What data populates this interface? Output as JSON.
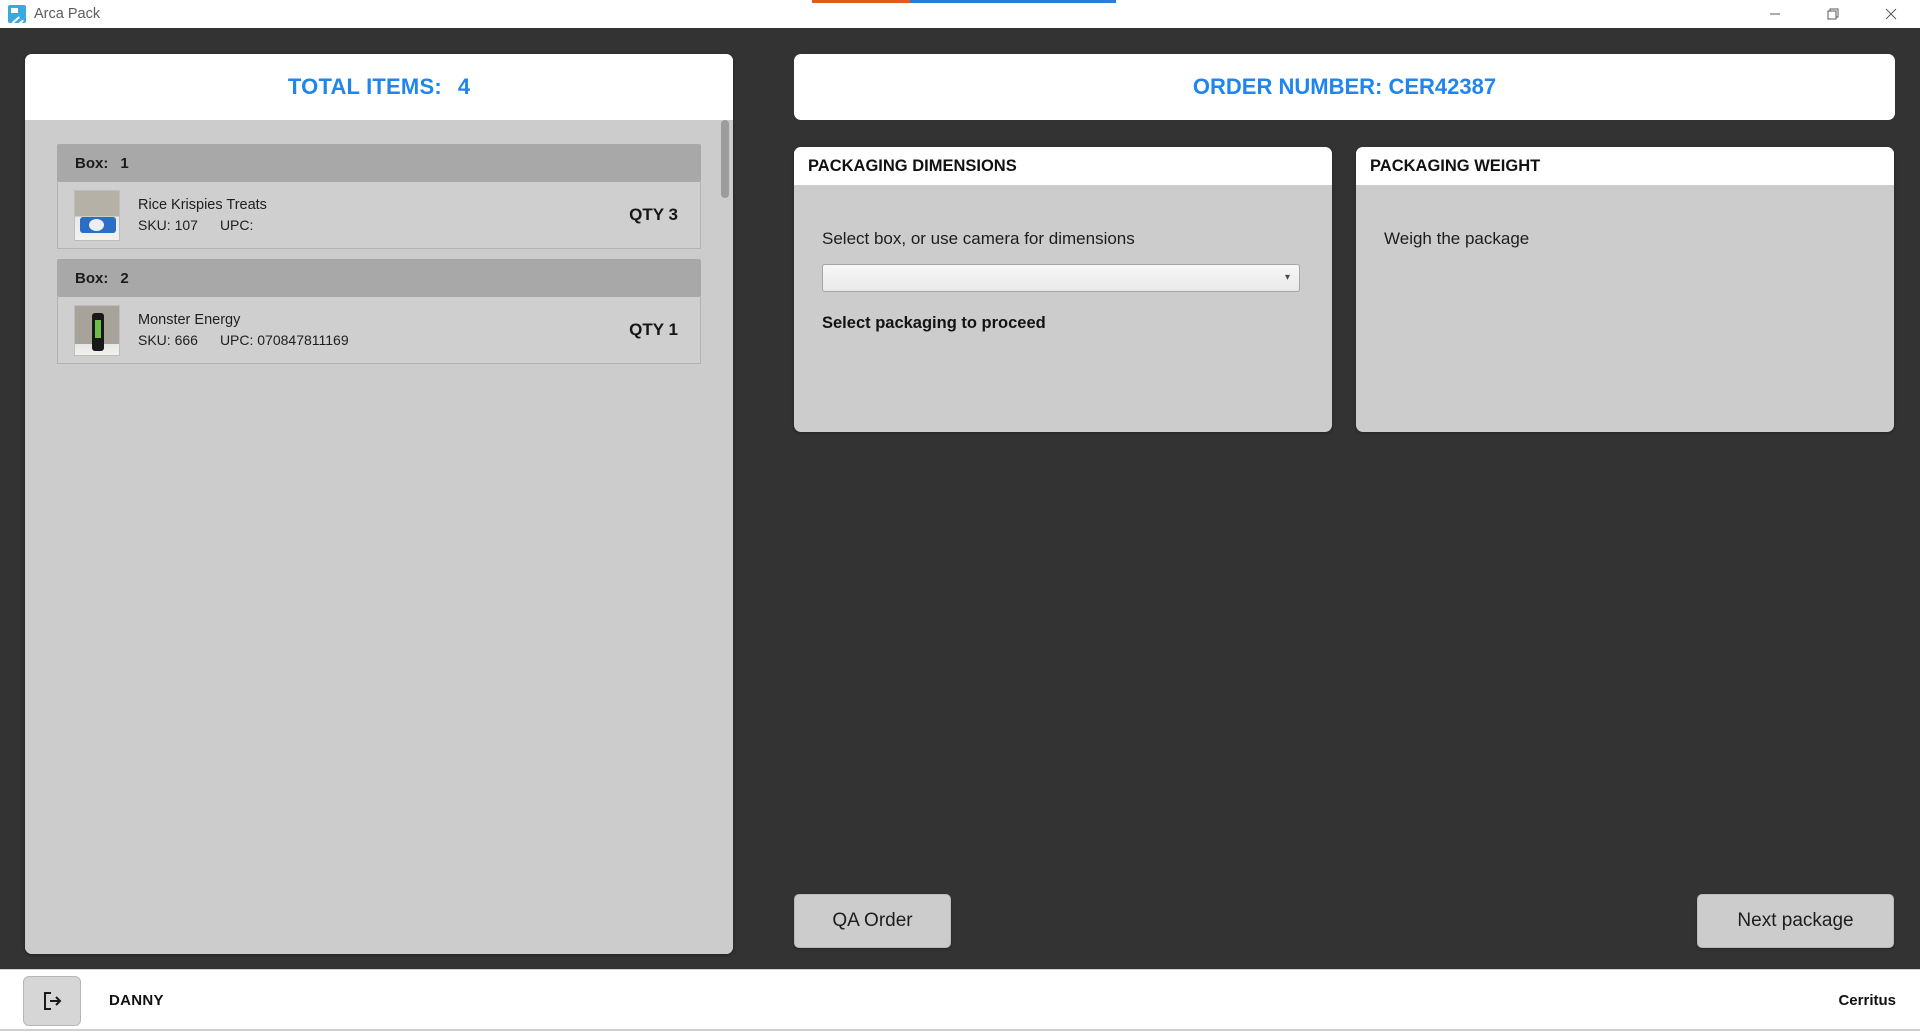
{
  "window": {
    "title": "Arca Pack",
    "app_icon": "arca-pack-logo-icon",
    "minimize_icon": "minimize-icon",
    "restore_icon": "restore-icon",
    "close_icon": "close-icon"
  },
  "left_panel": {
    "total_items_label": "TOTAL ITEMS:",
    "total_items_value": "4",
    "accent_color": "#2186eb",
    "boxes": [
      {
        "box_label": "Box:",
        "box_number": "1",
        "items": [
          {
            "name": "Rice Krispies Treats",
            "sku": "SKU: 107",
            "upc": "UPC:",
            "qty": "QTY 3",
            "thumb": "rice-krispies-treats-thumbnail"
          }
        ]
      },
      {
        "box_label": "Box:",
        "box_number": "2",
        "items": [
          {
            "name": "Monster Energy",
            "sku": "SKU: 666",
            "upc": "UPC: 070847811169",
            "qty": "QTY 1",
            "thumb": "monster-energy-thumbnail"
          }
        ]
      }
    ]
  },
  "right_panel": {
    "order_title": "ORDER NUMBER: CER42387",
    "dimensions_panel": {
      "title": "PACKAGING DIMENSIONS",
      "prompt": "Select box, or use camera for dimensions",
      "select_value": "",
      "select_placeholder": "",
      "chevron_icon": "chevron-down-icon",
      "note": "Select packaging to proceed"
    },
    "weight_panel": {
      "title": "PACKAGING WEIGHT",
      "prompt": "Weigh the package"
    }
  },
  "actions": {
    "qa_order_label": "QA Order",
    "next_package_label": "Next package"
  },
  "statusbar": {
    "logout_icon": "logout-icon",
    "user": "DANNY",
    "site": "Cerritus"
  }
}
